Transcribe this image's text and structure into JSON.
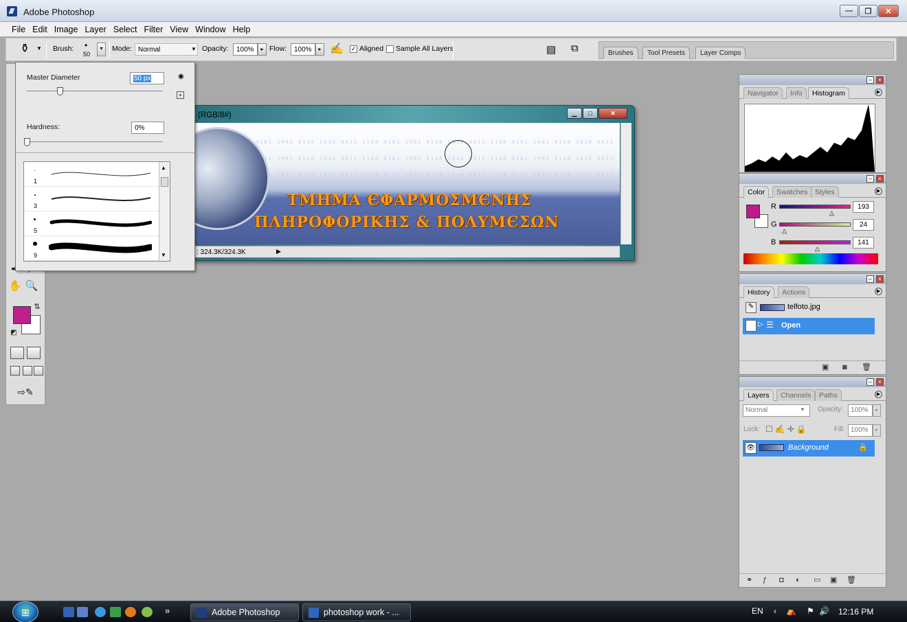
{
  "window": {
    "title": "Adobe Photoshop",
    "min_glyph": "—",
    "max_glyph": "❐",
    "close_glyph": "✕"
  },
  "menu": [
    "File",
    "Edit",
    "Image",
    "Layer",
    "Select",
    "Filter",
    "View",
    "Window",
    "Help"
  ],
  "options": {
    "brush_label": "Brush:",
    "brush_size": "50",
    "mode_label": "Mode:",
    "mode_value": "Normal",
    "opacity_label": "Opacity:",
    "opacity_value": "100%",
    "flow_label": "Flow:",
    "flow_value": "100%",
    "aligned_label": "Aligned",
    "aligned_checked": "✓",
    "sample_all_label": "Sample All Layers",
    "well_tabs": [
      "Brushes",
      "Tool Presets",
      "Layer Comps"
    ]
  },
  "brush_popup": {
    "master_diameter_label": "Master Diameter",
    "master_diameter_value": "50 px",
    "hardness_label": "Hardness:",
    "hardness_value": "0%",
    "brushes": [
      {
        "size": "1"
      },
      {
        "size": "3"
      },
      {
        "size": "5"
      },
      {
        "size": "9"
      }
    ]
  },
  "document": {
    "title": "(RGB/8#)",
    "status": ": 324.3K/324.3K",
    "banner_line1": "ΤΜΗΜΑ ЄΦΑΡΜΟΣΜЄΝΗΣ",
    "banner_line2": "ΠΛΗΡΟΦΟΡΙΚΗΣ & ΠΟΛΥΜЄΣΩΝ",
    "binary_pattern": "0101 1001 0110 1010 0011 1100 0101 1001 0110 1010 0011 1100 0101 1001 0110 1010 0011 1100 0101"
  },
  "navigator_panel": {
    "tabs": [
      "Navigator",
      "Info",
      "Histogram"
    ],
    "active_tab": "Histogram"
  },
  "color_panel": {
    "tabs": [
      "Color",
      "Swatches",
      "Styles"
    ],
    "active_tab": "Color",
    "r_label": "R",
    "g_label": "G",
    "b_label": "B",
    "r_value": "193",
    "g_value": "24",
    "b_value": "141",
    "foreground_color": "#c1188d"
  },
  "history_panel": {
    "tabs": [
      "History",
      "Actions"
    ],
    "active_tab": "History",
    "snapshot_name": "telfoto.jpg",
    "items": [
      "Open"
    ]
  },
  "layers_panel": {
    "tabs": [
      "Layers",
      "Channels",
      "Paths"
    ],
    "active_tab": "Layers",
    "blend_mode": "Normal",
    "opacity_label": "Opacity:",
    "opacity_value": "100%",
    "lock_label": "Lock:",
    "fill_label": "Fill:",
    "fill_value": "100%",
    "layers": [
      {
        "name": "Background",
        "locked": true
      }
    ]
  },
  "taskbar": {
    "tasks": [
      "Adobe Photoshop",
      "photoshop work - ..."
    ],
    "chevron": "»",
    "lang": "EN",
    "time": "12:16 PM"
  }
}
